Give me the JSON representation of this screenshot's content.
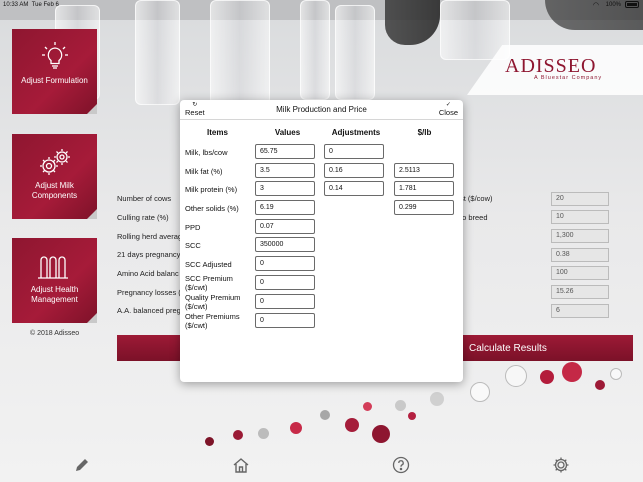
{
  "status_bar": {
    "time": "10:33 AM",
    "date": "Tue Feb 6",
    "battery": "100%"
  },
  "brand": {
    "name": "ADISSEO",
    "tagline": "A Bluestar Company",
    "accent": "#8e1630"
  },
  "sidebar": {
    "tiles": [
      {
        "label": "Adjust Formulation",
        "icon": "lightbulb-icon"
      },
      {
        "label": "Adjust Milk Components",
        "icon": "gears-icon"
      },
      {
        "label": "Adjust Health Management",
        "icon": "barn-icon"
      }
    ],
    "copyright": "© 2018 Adisseo"
  },
  "background_form": {
    "left_labels": [
      "Number of cows",
      "Culling rate (%)",
      "Rolling herd averag",
      "21 days pregnancy",
      "Amino Acid balanc",
      "Pregnancy losses (",
      "A.A. balanced preg"
    ],
    "right_labels": [
      "st ($/cow)",
      "to breed"
    ],
    "right_values": [
      "20",
      "10",
      "1,300",
      "0.38",
      "100",
      "15.26",
      "6"
    ],
    "calculate_label": "Calculate Results"
  },
  "toolbar": {
    "icons": [
      "pencil-icon",
      "home-icon",
      "help-icon",
      "settings-icon"
    ]
  },
  "modal": {
    "title": "Milk Production and Price",
    "reset_label": "Reset",
    "close_label": "Close",
    "columns": {
      "items": "Items",
      "values": "Values",
      "adjustments": "Adjustments",
      "price": "$/lb"
    },
    "rows": [
      {
        "label": "Milk, lbs/cow",
        "value": "65.75",
        "adjustment": "0"
      },
      {
        "label": "Milk fat (%)",
        "value": "3.5",
        "adjustment": "0.16",
        "price": "2.5113"
      },
      {
        "label": "Milk protein (%)",
        "value": "3",
        "adjustment": "0.14",
        "price": "1.781"
      },
      {
        "label": "Other solids (%)",
        "value": "6.19",
        "price": "0.299"
      },
      {
        "label": "PPD",
        "value": "0.07"
      },
      {
        "label": "SCC",
        "value": "350000"
      },
      {
        "label": "SCC Adjusted",
        "value": "0"
      },
      {
        "label": "SCC Premium ($/cwt)",
        "value": "0"
      },
      {
        "label": "Quality Premium ($/cwt)",
        "value": "0"
      },
      {
        "label": "Other Premiums ($/cwt)",
        "value": "0"
      }
    ]
  }
}
